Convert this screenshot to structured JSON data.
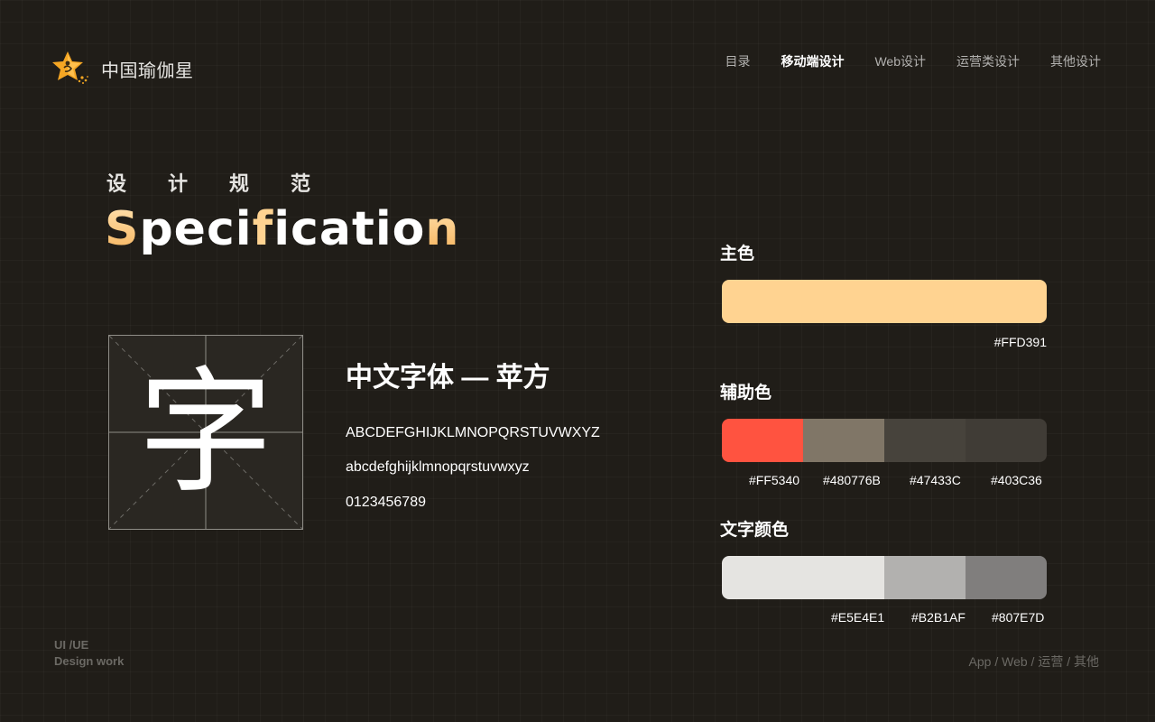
{
  "brand": {
    "name": "中国瑜伽星",
    "icon": "star-yoga-logo-icon",
    "accent": "#FFD391"
  },
  "nav": [
    {
      "label": "目录",
      "active": false
    },
    {
      "label": "移动端设计",
      "active": true
    },
    {
      "label": "Web设计",
      "active": false
    },
    {
      "label": "运营类设计",
      "active": false
    },
    {
      "label": "其他设计",
      "active": false
    }
  ],
  "hero": {
    "kicker": "设计规范",
    "title_parts": [
      "S",
      "peci",
      "f",
      "icatio",
      "n"
    ]
  },
  "font": {
    "sample_char": "字",
    "title": "中文字体 — 苹方",
    "uppercase": "ABCDEFGHIJKLMNOPQRSTUVWXYZ",
    "lowercase": "abcdefghijklmnopqrstuvwxyz",
    "digits": "0123456789"
  },
  "colors": {
    "primary": {
      "label": "主色",
      "hex": "#FFD391",
      "value": "#FFD391"
    },
    "secondary": {
      "label": "辅助色",
      "swatches": [
        {
          "hex": "#FF5340",
          "value": "#FF5340",
          "share": 0.25
        },
        {
          "hex": "#480776B",
          "value": "#807667",
          "share": 0.25
        },
        {
          "hex": "#47433C",
          "value": "#47433C",
          "share": 0.25
        },
        {
          "hex": "#403C36",
          "value": "#403C36",
          "share": 0.25
        }
      ]
    },
    "text": {
      "label": "文字颜色",
      "swatches": [
        {
          "hex": "#E5E4E1",
          "value": "#E5E4E1",
          "share": 0.5
        },
        {
          "hex": "#B2B1AF",
          "value": "#B2B1AF",
          "share": 0.25
        },
        {
          "hex": "#807E7D",
          "value": "#807E7D",
          "share": 0.25
        }
      ]
    }
  },
  "footer": {
    "left_line1": "UI /UE",
    "left_line2": "Design work",
    "right": "App / Web / 运营 / 其他"
  }
}
